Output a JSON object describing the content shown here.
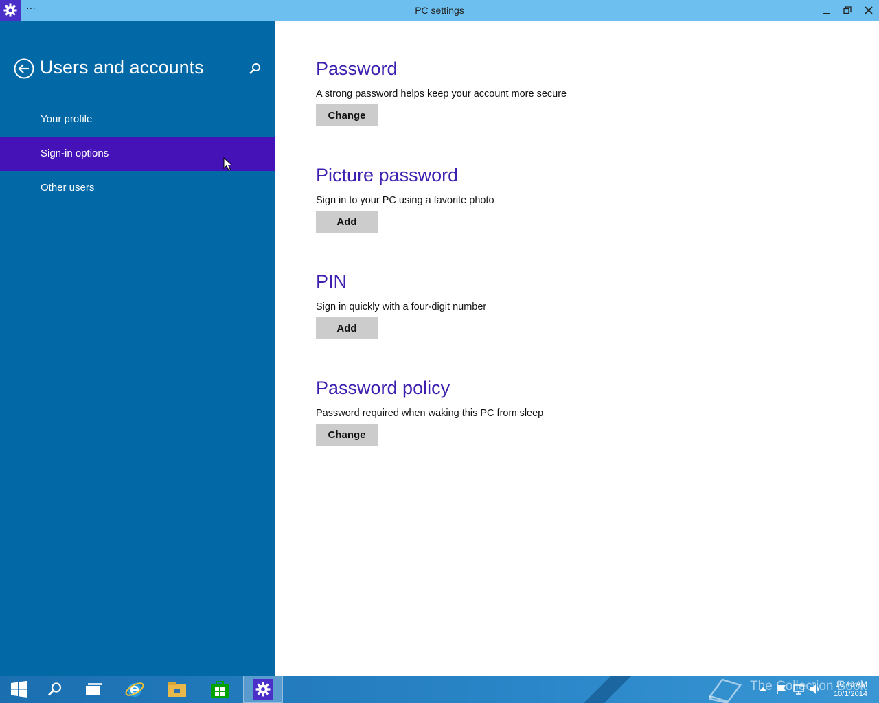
{
  "window": {
    "title": "PC settings",
    "menu_dots": "···"
  },
  "sidebar": {
    "title": "Users and accounts",
    "items": [
      {
        "label": "Your profile",
        "active": false
      },
      {
        "label": "Sign-in options",
        "active": true
      },
      {
        "label": "Other users",
        "active": false
      }
    ]
  },
  "sections": [
    {
      "heading": "Password",
      "description": "A strong password helps keep your account more secure",
      "button": "Change"
    },
    {
      "heading": "Picture password",
      "description": "Sign in to your PC using a favorite photo",
      "button": "Add"
    },
    {
      "heading": "PIN",
      "description": "Sign in quickly with a four-digit number",
      "button": "Add"
    },
    {
      "heading": "Password policy",
      "description": "Password required when waking this PC from sleep",
      "button": "Change"
    }
  ],
  "taskbar": {
    "items": [
      "start-icon",
      "search-icon",
      "task-view-icon",
      "internet-explorer-icon",
      "file-explorer-icon",
      "store-icon",
      "settings-icon"
    ],
    "active_item": "settings-icon",
    "watermark": "The Collection Book",
    "clock_time": "10:43 AM",
    "clock_date": "10/1/2014"
  },
  "colors": {
    "sidebar": "#0268a6",
    "sidebar_active": "#4512b8",
    "heading": "#3e1fb0",
    "titlebar": "#6cbfee",
    "button": "#cccccc"
  }
}
